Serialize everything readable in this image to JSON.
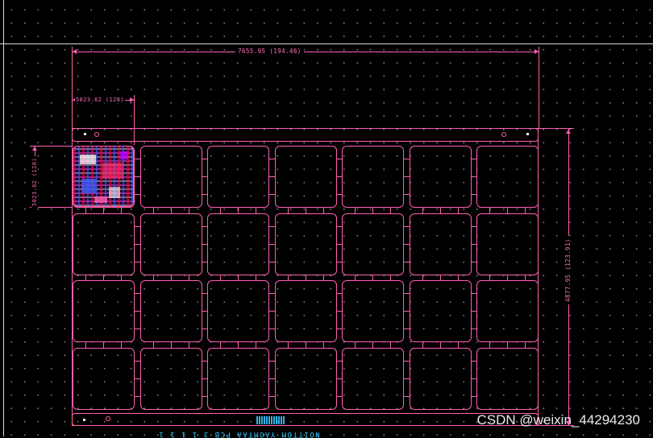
{
  "canvas": {
    "background": "#000000",
    "outline_color": "#ff5fb0",
    "grid_dot_color": "#7a7a7a",
    "silkscreen_color": "#35c7ff"
  },
  "dimensions": {
    "panel_width": "7655.95 (194.46)",
    "unit_width": "5023.62 (128)",
    "unit_height": "5023.62 (128)",
    "panel_height": "4877.95 (123.91)"
  },
  "panel": {
    "rows": 4,
    "columns": 7,
    "unit_count": 28
  },
  "bottom_rail": {
    "mirrored_text": "NOITTOM YAOMTAA PCB 3 1 1 1 1"
  },
  "watermark": {
    "text": "CSDN @weixin_44294230"
  },
  "icons": {
    "pcb_artwork": "pcb-layout-thumbnail",
    "fiducial": "fiducial-dot",
    "tooling_hole": "tooling-hole"
  }
}
